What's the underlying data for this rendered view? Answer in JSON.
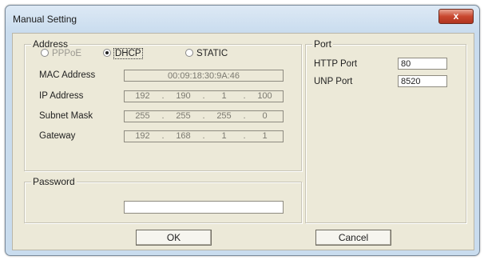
{
  "window": {
    "title": "Manual Setting",
    "close_glyph": "x"
  },
  "address": {
    "legend": "Address",
    "modes": [
      {
        "label": "PPPoE",
        "selected": false,
        "enabled": false
      },
      {
        "label": "DHCP",
        "selected": true,
        "enabled": true
      },
      {
        "label": "STATIC",
        "selected": false,
        "enabled": true
      }
    ],
    "mac_label": "MAC Address",
    "mac_value": "00:09:18:30:9A:46",
    "ip_label": "IP Address",
    "ip": [
      "192",
      "190",
      "1",
      "100"
    ],
    "mask_label": "Subnet Mask",
    "mask": [
      "255",
      "255",
      "255",
      "0"
    ],
    "gateway_label": "Gateway",
    "gateway": [
      "192",
      "168",
      "1",
      "1"
    ]
  },
  "port": {
    "legend": "Port",
    "http_label": "HTTP Port",
    "http_value": "80",
    "unp_label": "UNP Port",
    "unp_value": "8520"
  },
  "password": {
    "legend": "Password",
    "value": ""
  },
  "buttons": {
    "ok": "OK",
    "cancel": "Cancel"
  }
}
